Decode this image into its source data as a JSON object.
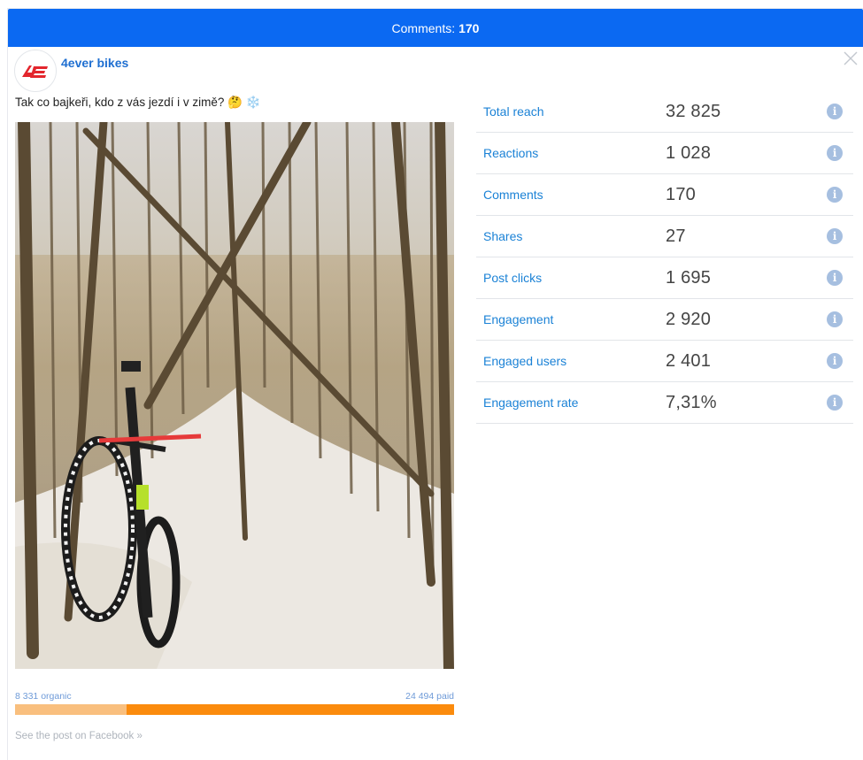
{
  "header": {
    "label": "Comments:",
    "count": "170"
  },
  "page": {
    "name": "4ever bikes",
    "logo_text": "4E"
  },
  "post": {
    "text": "Tak co bajkeři, kdo z vás jezdí i v zimě? 🤔 ❄️"
  },
  "reach_split": {
    "organic_label": "8 331 organic",
    "paid_label": "24 494 paid",
    "organic_fraction": 0.2538
  },
  "see_post_link": "See the post on Facebook »",
  "stats": [
    {
      "label": "Total reach",
      "value": "32 825"
    },
    {
      "label": "Reactions",
      "value": "1 028"
    },
    {
      "label": "Comments",
      "value": "170"
    },
    {
      "label": "Shares",
      "value": "27"
    },
    {
      "label": "Post clicks",
      "value": "1 695"
    },
    {
      "label": "Engagement",
      "value": "2 920"
    },
    {
      "label": "Engaged users",
      "value": "2 401"
    },
    {
      "label": "Engagement rate",
      "value": "7,31%"
    }
  ],
  "colors": {
    "header": "#0b69f2",
    "link": "#1b82d6",
    "organic": "#f9bf7e",
    "paid": "#fb8b0d",
    "brand_red": "#e3262d"
  }
}
